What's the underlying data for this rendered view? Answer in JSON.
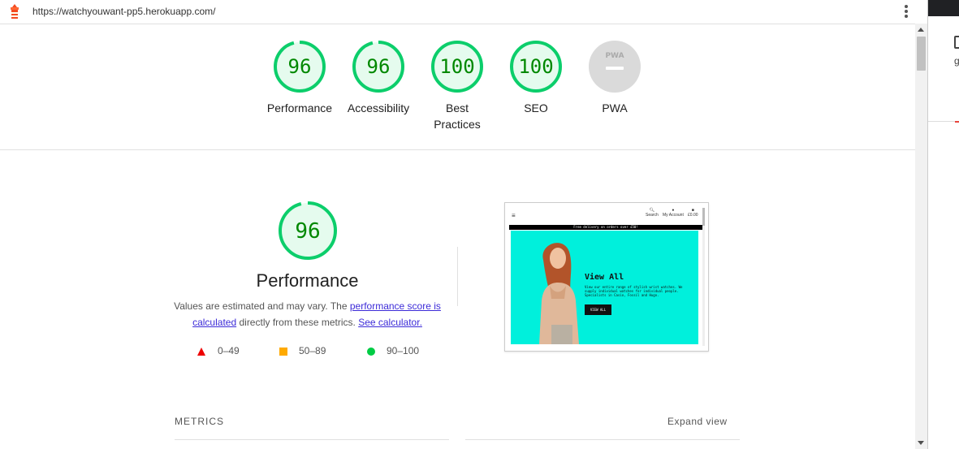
{
  "url_bar": {
    "url": "https://watchyouwant-pp5.herokuapp.com/"
  },
  "gauges": [
    {
      "label": "Performance",
      "score": "96"
    },
    {
      "label": "Accessibility",
      "score": "96"
    },
    {
      "label": "Best Practices",
      "score": "100"
    },
    {
      "label": "SEO",
      "score": "100"
    },
    {
      "label": "PWA",
      "score": "",
      "badge": "PWA"
    }
  ],
  "performance": {
    "score": "96",
    "title": "Performance",
    "desc_prefix": "Values are estimated and may vary. The ",
    "link_score": "performance score is calculated",
    "desc_middle": " directly from these metrics. ",
    "link_calc": "See calculator."
  },
  "legend": [
    {
      "range": "0–49",
      "icon": "triangle",
      "color": "#ee0000"
    },
    {
      "range": "50–89",
      "icon": "square",
      "color": "#ffaa00"
    },
    {
      "range": "90–100",
      "icon": "circle",
      "color": "#00cc44"
    }
  ],
  "screenshot": {
    "nav": [
      "Search",
      "My Account",
      "£0.00"
    ],
    "banner": "Free delivery on orders over £50!",
    "heading": "View All",
    "paragraph": "View our entire range of stylish wrist watches. We supply individual watches for individual people. Specialists in Casio, Fossil and Hugo.",
    "button": "VIEW ALL"
  },
  "metrics": {
    "label": "METRICS",
    "expand": "Expand view"
  },
  "side_panel": {
    "letter": "g"
  },
  "colors": {
    "pass": "#0cce6b",
    "pass_text": "#008800",
    "pwa_gray": "#dadada"
  }
}
